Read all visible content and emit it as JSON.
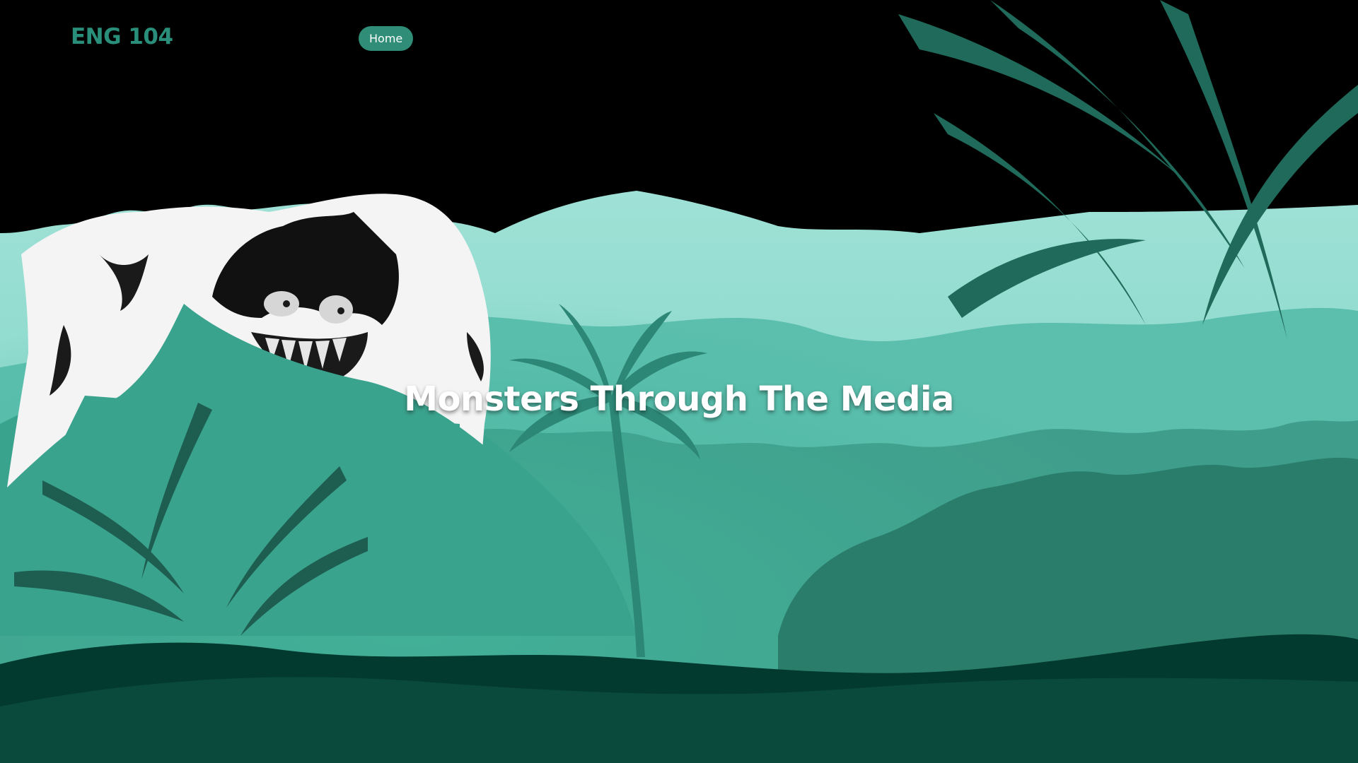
{
  "header": {
    "brand": "ENG 104",
    "nav": {
      "home_label": "Home"
    }
  },
  "hero": {
    "title": "Monsters Through The Media",
    "background": {
      "description_icon": "jungle-monster-illustration",
      "colors": {
        "sky": "#000000",
        "far_hills": "#9ee3da",
        "mid_hills": "#5cbfae",
        "near_hills": "#3a9b88",
        "foliage": "#1f6a5a",
        "ground": "#033a30",
        "accent": "#2f8d78"
      }
    }
  }
}
